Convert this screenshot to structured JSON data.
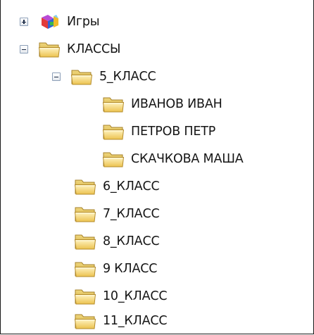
{
  "tree": {
    "nodes": [
      {
        "label": "Игры",
        "icon": "games-icon",
        "state": "collapsed"
      },
      {
        "label": "КЛАССЫ",
        "icon": "folder-icon",
        "state": "expanded"
      },
      {
        "label": "5_КЛАСС",
        "icon": "folder-icon",
        "state": "expanded"
      },
      {
        "label": "ИВАНОВ ИВАН",
        "icon": "folder-icon"
      },
      {
        "label": "ПЕТРОВ ПЕТР",
        "icon": "folder-icon"
      },
      {
        "label": "СКАЧКОВА МАША",
        "icon": "folder-icon"
      },
      {
        "label": "6_КЛАСС",
        "icon": "folder-icon"
      },
      {
        "label": "7_КЛАСС",
        "icon": "folder-icon"
      },
      {
        "label": "8_КЛАСС",
        "icon": "folder-icon"
      },
      {
        "label": "9 КЛАСС",
        "icon": "folder-icon"
      },
      {
        "label": "10_КЛАСС",
        "icon": "folder-icon"
      },
      {
        "label": "11_КЛАСС",
        "icon": "folder-icon"
      }
    ]
  }
}
